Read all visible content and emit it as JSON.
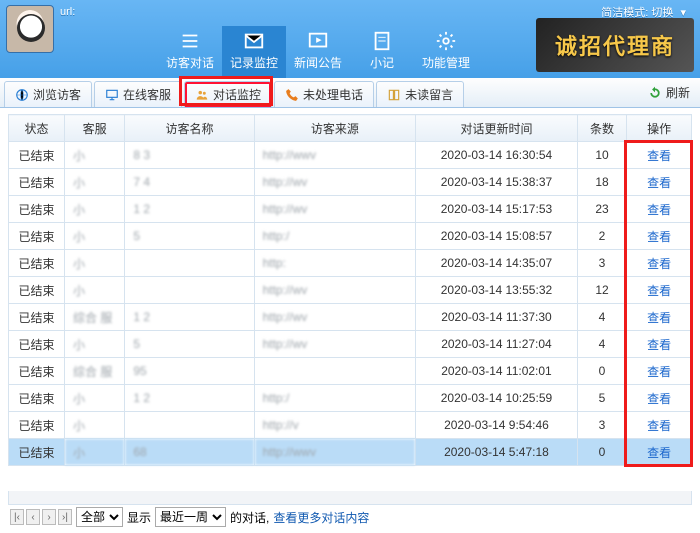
{
  "header": {
    "url_label": "url:",
    "mode_label": "简洁模式:",
    "mode_action": "切换",
    "banner_text": "诚招代理商",
    "nav": [
      {
        "label": "访客对话",
        "icon": "list-icon"
      },
      {
        "label": "记录监控",
        "icon": "mail-icon",
        "active": true
      },
      {
        "label": "新闻公告",
        "icon": "play-icon"
      },
      {
        "label": "小记",
        "icon": "note-icon"
      },
      {
        "label": "功能管理",
        "icon": "gear-icon"
      }
    ]
  },
  "subtabs": [
    {
      "label": "浏览访客",
      "icon": "globe-icon"
    },
    {
      "label": "在线客服",
      "icon": "monitor-icon"
    },
    {
      "label": "对话监控",
      "icon": "people-icon",
      "highlight": true
    },
    {
      "label": "未处理电话",
      "icon": "phone-icon"
    },
    {
      "label": "未读留言",
      "icon": "book-icon"
    }
  ],
  "refresh_label": "刷新",
  "columns": [
    "状态",
    "客服",
    "访客名称",
    "访客来源",
    "对话更新时间",
    "条数",
    "操作"
  ],
  "rows": [
    {
      "status": "已结束",
      "agent": "小",
      "visitor": "8      3",
      "source": "http://wwv",
      "time": "2020-03-14 16:30:54",
      "count": 10,
      "action": "查看"
    },
    {
      "status": "已结束",
      "agent": "小",
      "visitor": "7      4",
      "source": "http://wv",
      "time": "2020-03-14 15:38:37",
      "count": 18,
      "action": "查看"
    },
    {
      "status": "已结束",
      "agent": "小",
      "visitor": "1      2",
      "source": "http://wv",
      "time": "2020-03-14 15:17:53",
      "count": 23,
      "action": "查看"
    },
    {
      "status": "已结束",
      "agent": "小",
      "visitor": "      5",
      "source": "http:/",
      "time": "2020-03-14 15:08:57",
      "count": 2,
      "action": "查看"
    },
    {
      "status": "已结束",
      "agent": "小",
      "visitor": "",
      "source": "http:",
      "time": "2020-03-14 14:35:07",
      "count": 3,
      "action": "查看"
    },
    {
      "status": "已结束",
      "agent": "小",
      "visitor": "",
      "source": "http://wv",
      "time": "2020-03-14 13:55:32",
      "count": 12,
      "action": "查看"
    },
    {
      "status": "已结束",
      "agent": "综合   服",
      "visitor": "1     2",
      "source": "http://wv",
      "time": "2020-03-14 11:37:30",
      "count": 4,
      "action": "查看"
    },
    {
      "status": "已结束",
      "agent": "小",
      "visitor": "      5",
      "source": "http://wv",
      "time": "2020-03-14 11:27:04",
      "count": 4,
      "action": "查看"
    },
    {
      "status": "已结束",
      "agent": "综合   服",
      "visitor": "     95",
      "source": "",
      "time": "2020-03-14 11:02:01",
      "count": 0,
      "action": "查看"
    },
    {
      "status": "已结束",
      "agent": "小",
      "visitor": "1     2",
      "source": "http:/",
      "time": "2020-03-14 10:25:59",
      "count": 5,
      "action": "查看"
    },
    {
      "status": "已结束",
      "agent": "小",
      "visitor": "",
      "source": "http://v",
      "time": "2020-03-14 9:54:46",
      "count": 3,
      "action": "查看"
    },
    {
      "status": "已结束",
      "agent": "小",
      "visitor": "68",
      "source": "http://wwv",
      "time": "2020-03-14 5:47:18",
      "count": 0,
      "action": "查看",
      "selected": true
    }
  ],
  "footer": {
    "filter_all": "全部",
    "show_label": "显示",
    "range": "最近一周",
    "suffix": "的对话,",
    "more": "查看更多对话内容"
  }
}
